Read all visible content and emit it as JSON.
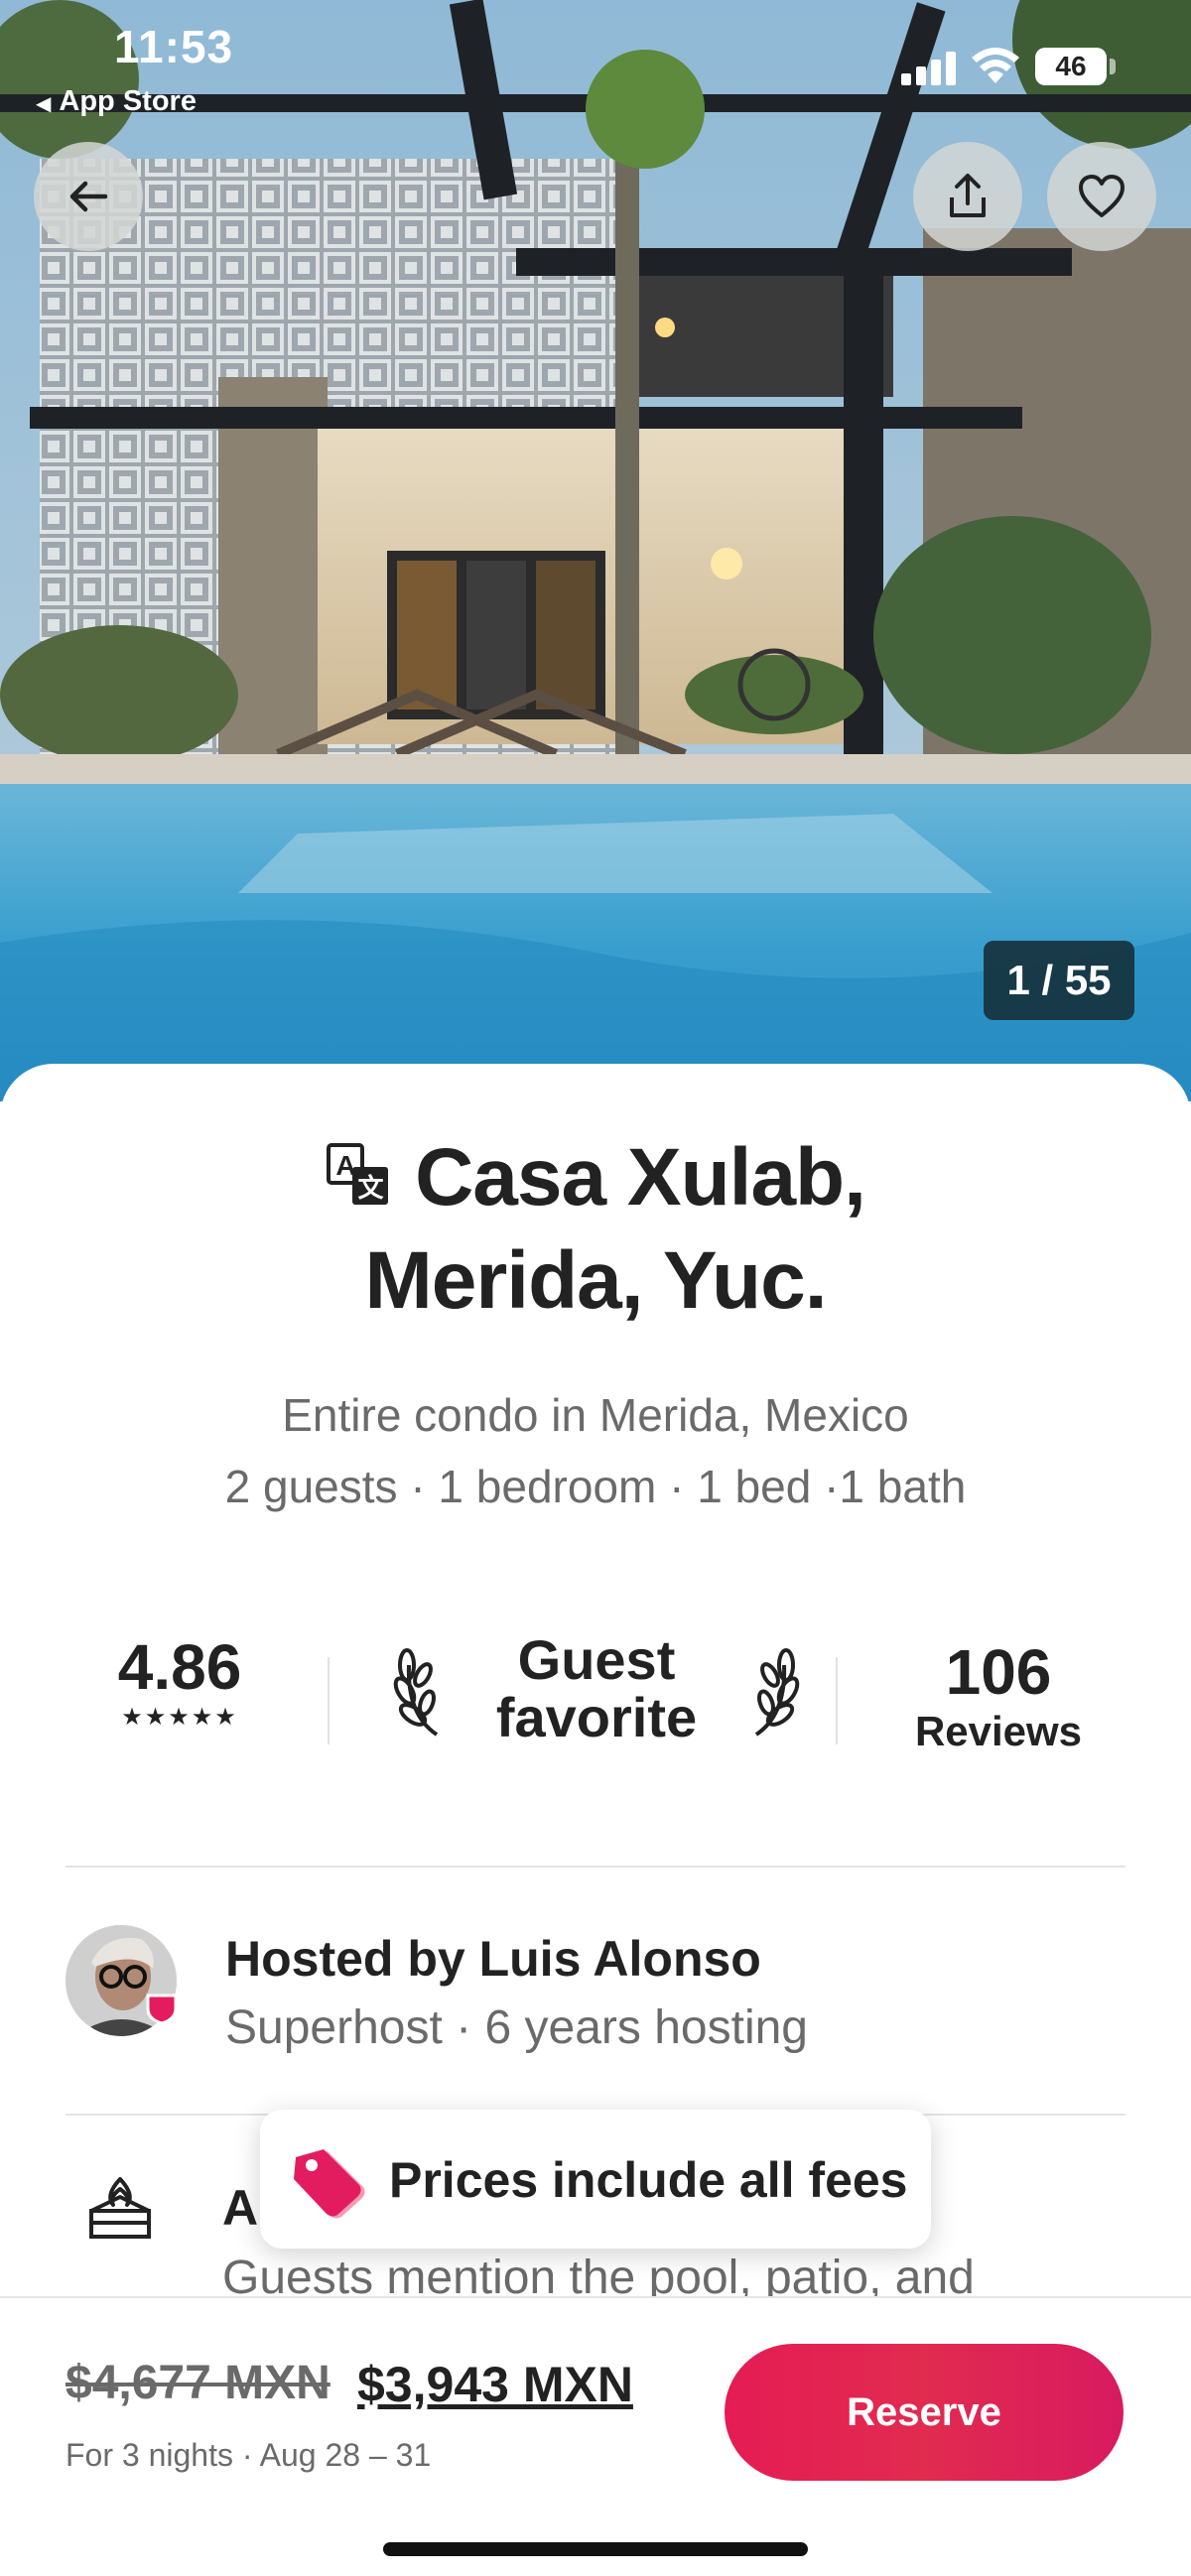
{
  "status_bar": {
    "time": "11:53",
    "back_app": "App Store",
    "battery": "46"
  },
  "hero": {
    "counter": "1 / 55"
  },
  "listing": {
    "title_line1": "Casa Xulab,",
    "title_line2": "Merida, Yuc.",
    "subtitle_line1": "Entire condo in Merida, Mexico",
    "subtitle_line2": "2 guests · 1 bedroom · 1 bed ·1 bath"
  },
  "stats": {
    "rating": "4.86",
    "stars": "★★★★★",
    "guest_favorite_line1": "Guest",
    "guest_favorite_line2": "favorite",
    "reviews_count": "106",
    "reviews_label": "Reviews"
  },
  "host": {
    "name": "Hosted by Luis Alonso",
    "subtitle": "Superhost · 6 years hosting"
  },
  "highlight": {
    "title_visible": "A",
    "description": "Guests mention the pool, patio, and"
  },
  "toast": {
    "message": "Prices include all fees"
  },
  "booking": {
    "original_price": "$4,677 MXN",
    "price": "$3,943 MXN",
    "dates": "For 3 nights · Aug 28 – 31",
    "reserve_label": "Reserve"
  },
  "colors": {
    "accent": "#E31C5F",
    "text": "#222222",
    "muted": "#6A6A6A"
  },
  "icons": {
    "back": "arrow-left-icon",
    "share": "share-icon",
    "favorite": "heart-icon",
    "translate": "translate-icon",
    "laurel": "laurel-icon",
    "pool": "pool-icon",
    "tag": "price-tag-icon"
  }
}
